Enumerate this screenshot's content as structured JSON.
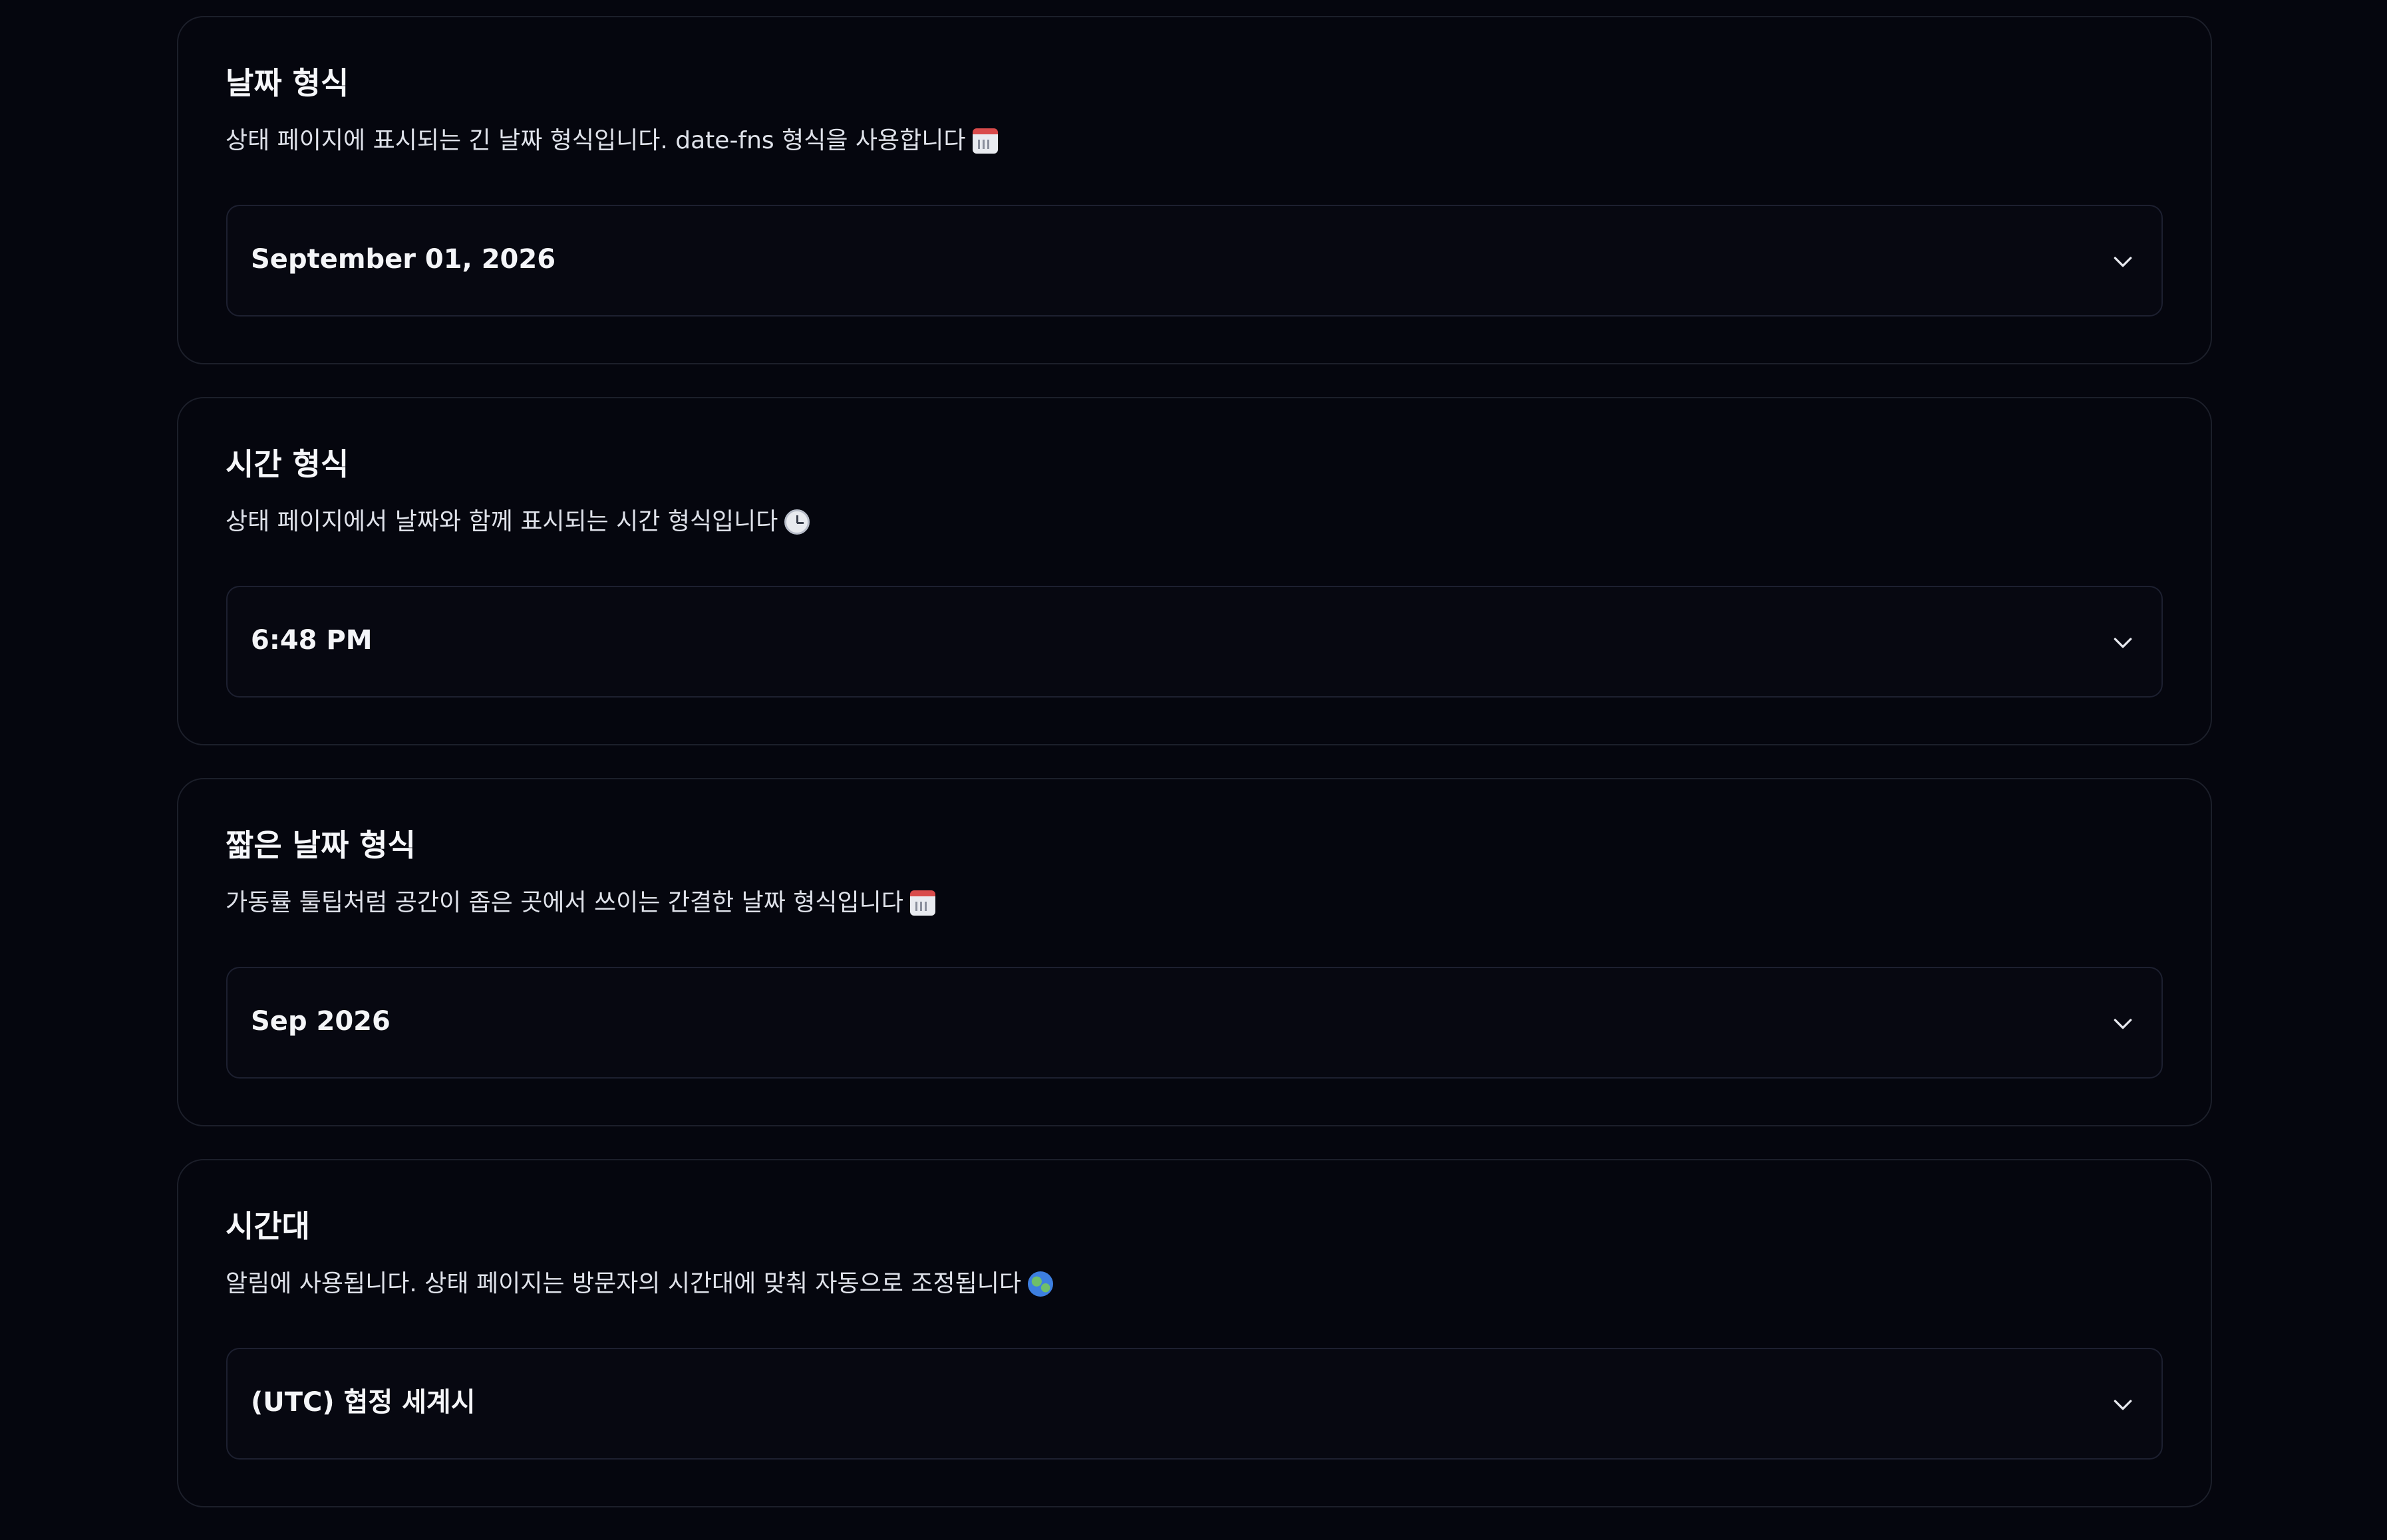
{
  "settings": [
    {
      "title": "날짜 형식",
      "description": "상태 페이지에 표시되는 긴 날짜 형식입니다. date-fns 형식을 사용합니다",
      "icon": "calendar-icon",
      "selected": "September 01, 2026"
    },
    {
      "title": "시간 형식",
      "description": "상태 페이지에서 날짜와 함께 표시되는 시간 형식입니다",
      "icon": "clock-icon",
      "selected": "6:48 PM"
    },
    {
      "title": "짧은 날짜 형식",
      "description": "가동률 툴팁처럼 공간이 좁은 곳에서 쓰이는 간결한 날짜 형식입니다",
      "icon": "calendar-icon",
      "selected": "Sep 2026"
    },
    {
      "title": "시간대",
      "description": "알림에 사용됩니다. 상태 페이지는 방문자의 시간대에 맞춰 자동으로 조정됩니다",
      "icon": "globe-icon",
      "selected": "(UTC) 협정 세계시"
    }
  ],
  "colors": {
    "background": "#05060e",
    "card_border": "#1c1f2a",
    "text": "#f4f5f8"
  }
}
